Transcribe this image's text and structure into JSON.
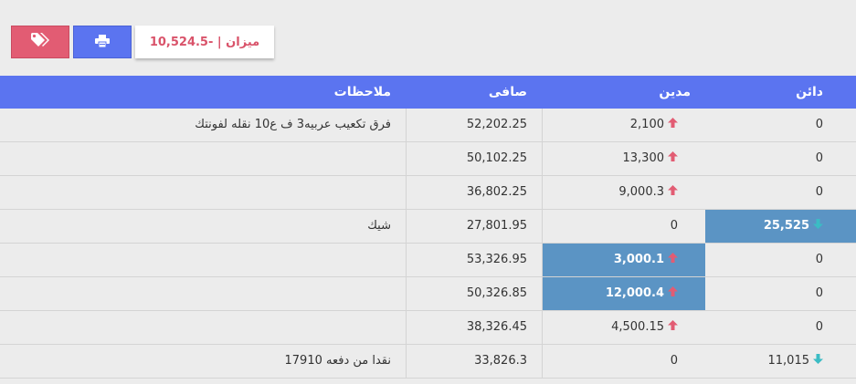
{
  "toolbar": {
    "tag_icon": "tags-icon",
    "print_icon": "print-icon",
    "balance_label": "ميزان | -10,524.5"
  },
  "colors": {
    "header_bg": "#5b74f0",
    "tag_button": "#e25c73",
    "print_button": "#5b74f0",
    "highlight": "#5b94c4",
    "up_arrow": "#e25c73",
    "down_arrow": "#3bbcc4"
  },
  "table": {
    "headers": {
      "credit": "دائن",
      "debit": "مدين",
      "net": "صافى",
      "notes": "ملاحظات"
    },
    "rows": [
      {
        "credit": "0",
        "credit_arrow": "",
        "debit": "2,100",
        "debit_arrow": "up",
        "net": "52,202.25",
        "notes": "فرق تكعيب عربيه3 ف ع10 نقله لفونتك",
        "highlight": ""
      },
      {
        "credit": "0",
        "credit_arrow": "",
        "debit": "13,300",
        "debit_arrow": "up",
        "net": "50,102.25",
        "notes": "",
        "highlight": ""
      },
      {
        "credit": "0",
        "credit_arrow": "",
        "debit": "9,000.3",
        "debit_arrow": "up",
        "net": "36,802.25",
        "notes": "",
        "highlight": ""
      },
      {
        "credit": "25,525",
        "credit_arrow": "down",
        "debit": "0",
        "debit_arrow": "",
        "net": "27,801.95",
        "notes": "شيك",
        "highlight": "credit"
      },
      {
        "credit": "0",
        "credit_arrow": "",
        "debit": "3,000.1",
        "debit_arrow": "up",
        "net": "53,326.95",
        "notes": "",
        "highlight": "debit"
      },
      {
        "credit": "0",
        "credit_arrow": "",
        "debit": "12,000.4",
        "debit_arrow": "up",
        "net": "50,326.85",
        "notes": "",
        "highlight": "debit"
      },
      {
        "credit": "0",
        "credit_arrow": "",
        "debit": "4,500.15",
        "debit_arrow": "up",
        "net": "38,326.45",
        "notes": "",
        "highlight": ""
      },
      {
        "credit": "11,015",
        "credit_arrow": "down",
        "debit": "0",
        "debit_arrow": "",
        "net": "33,826.3",
        "notes": "نقدا من دفعه 17910",
        "highlight": ""
      }
    ]
  }
}
